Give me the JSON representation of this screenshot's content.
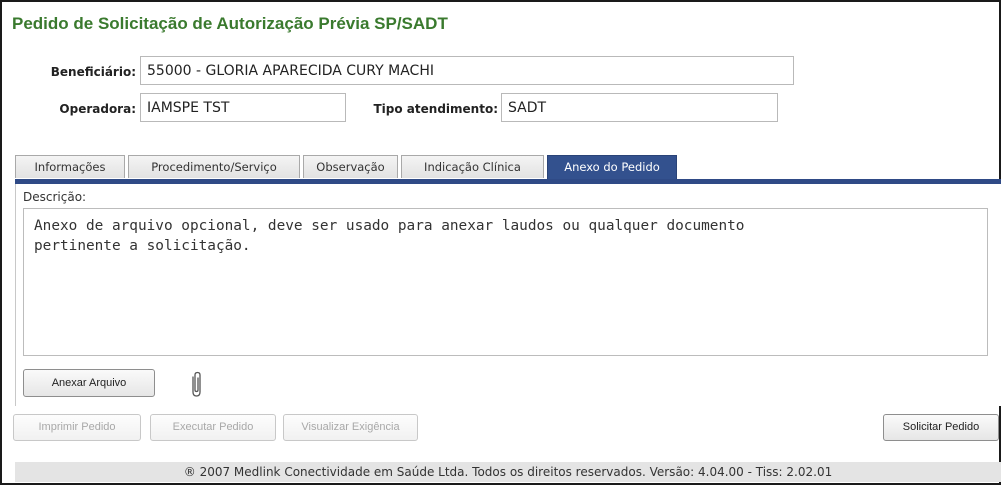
{
  "page": {
    "title": "Pedido de Solicitação de Autorização Prévia SP/SADT"
  },
  "form": {
    "beneficiario_label": "Beneficiário:",
    "beneficiario_value": "55000 - GLORIA APARECIDA CURY MACHI",
    "operadora_label": "Operadora:",
    "operadora_value": "IAMSPE TST",
    "tipo_label": "Tipo atendimento:",
    "tipo_value": "SADT"
  },
  "tabs": [
    {
      "label": "Informações",
      "active": false
    },
    {
      "label": "Procedimento/Serviço",
      "active": false
    },
    {
      "label": "Observação",
      "active": false
    },
    {
      "label": "Indicação Clínica",
      "active": false
    },
    {
      "label": "Anexo do Pedido",
      "active": true
    }
  ],
  "anexo": {
    "descricao_label": "Descrição:",
    "descricao_text": "Anexo de arquivo opcional, deve ser usado para anexar laudos ou qualquer documento\npertinente a solicitação.",
    "anexar_button": "Anexar Arquivo",
    "attachment_icon": "paperclip-icon"
  },
  "actions": {
    "imprimir": "Imprimir Pedido",
    "executar": "Executar Pedido",
    "visualizar": "Visualizar Exigência",
    "solicitar": "Solicitar Pedido"
  },
  "footer": {
    "text": "® 2007  Medlink Conectividade em Saúde Ltda.  Todos os direitos reservados.  Versão: 4.04.00 - Tiss: 2.02.01"
  },
  "colors": {
    "title_green": "#3a7a2e",
    "tab_active": "#33518e",
    "footer_bg": "#e4e4e4"
  }
}
